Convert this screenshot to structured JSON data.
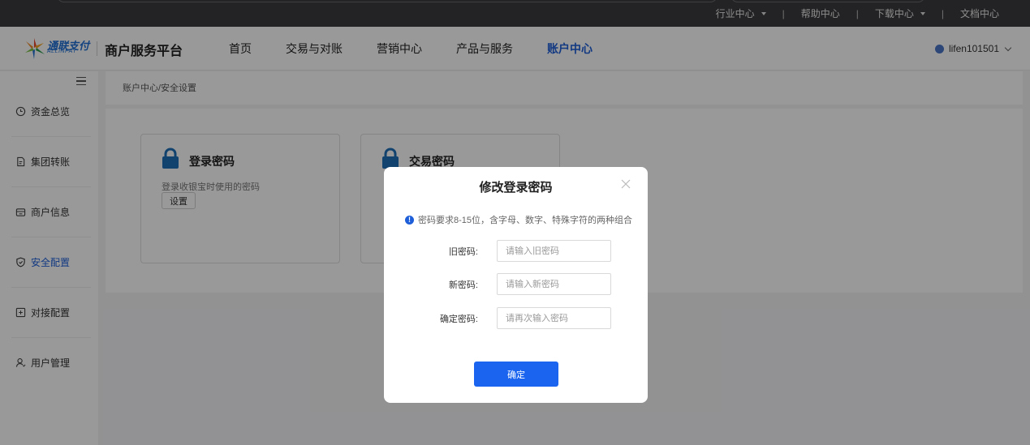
{
  "utility_bar": {
    "links": [
      {
        "label": "行业中心",
        "dropdown": true
      },
      {
        "label": "帮助中心",
        "dropdown": false
      },
      {
        "label": "下载中心",
        "dropdown": true
      },
      {
        "label": "文档中心",
        "dropdown": false
      }
    ]
  },
  "header": {
    "logo_text": "通联支付",
    "logo_sub": "ALLINPAY",
    "platform_title": "商户服务平台",
    "nav": [
      {
        "label": "首页",
        "active": false
      },
      {
        "label": "交易与对账",
        "active": false
      },
      {
        "label": "营销中心",
        "active": false
      },
      {
        "label": "产品与服务",
        "active": false
      },
      {
        "label": "账户中心",
        "active": true
      }
    ],
    "username": "lifen101501"
  },
  "sidebar": {
    "items": [
      {
        "label": "资金总览",
        "icon": "clock-icon",
        "active": false
      },
      {
        "label": "集团转账",
        "icon": "document-icon",
        "active": false
      },
      {
        "label": "商户信息",
        "icon": "store-icon",
        "active": false
      },
      {
        "label": "安全配置",
        "icon": "shield-icon",
        "active": true
      },
      {
        "label": "对接配置",
        "icon": "connect-icon",
        "active": false
      },
      {
        "label": "用户管理",
        "icon": "user-icon",
        "active": false
      }
    ]
  },
  "breadcrumb": "账户中心/安全设置",
  "cards": [
    {
      "title": "登录密码",
      "desc": "登录收银宝时使用的密码",
      "button": "设置"
    },
    {
      "title": "交易密码",
      "desc": "",
      "button": ""
    }
  ],
  "modal": {
    "title": "修改登录密码",
    "tip": "密码要求8-15位，含字母、数字、特殊字符的两种组合",
    "fields": [
      {
        "label": "旧密码:",
        "placeholder": "请输入旧密码",
        "value": ""
      },
      {
        "label": "新密码:",
        "placeholder": "请输入新密码",
        "value": ""
      },
      {
        "label": "确定密码:",
        "placeholder": "请再次输入密码",
        "value": ""
      }
    ],
    "confirm_label": "确定"
  },
  "colors": {
    "accent": "#1e5fd9",
    "primary_button": "#1a64f0",
    "utility_bar": "#3b3b3e",
    "lock_icon": "#1f6fb8"
  }
}
